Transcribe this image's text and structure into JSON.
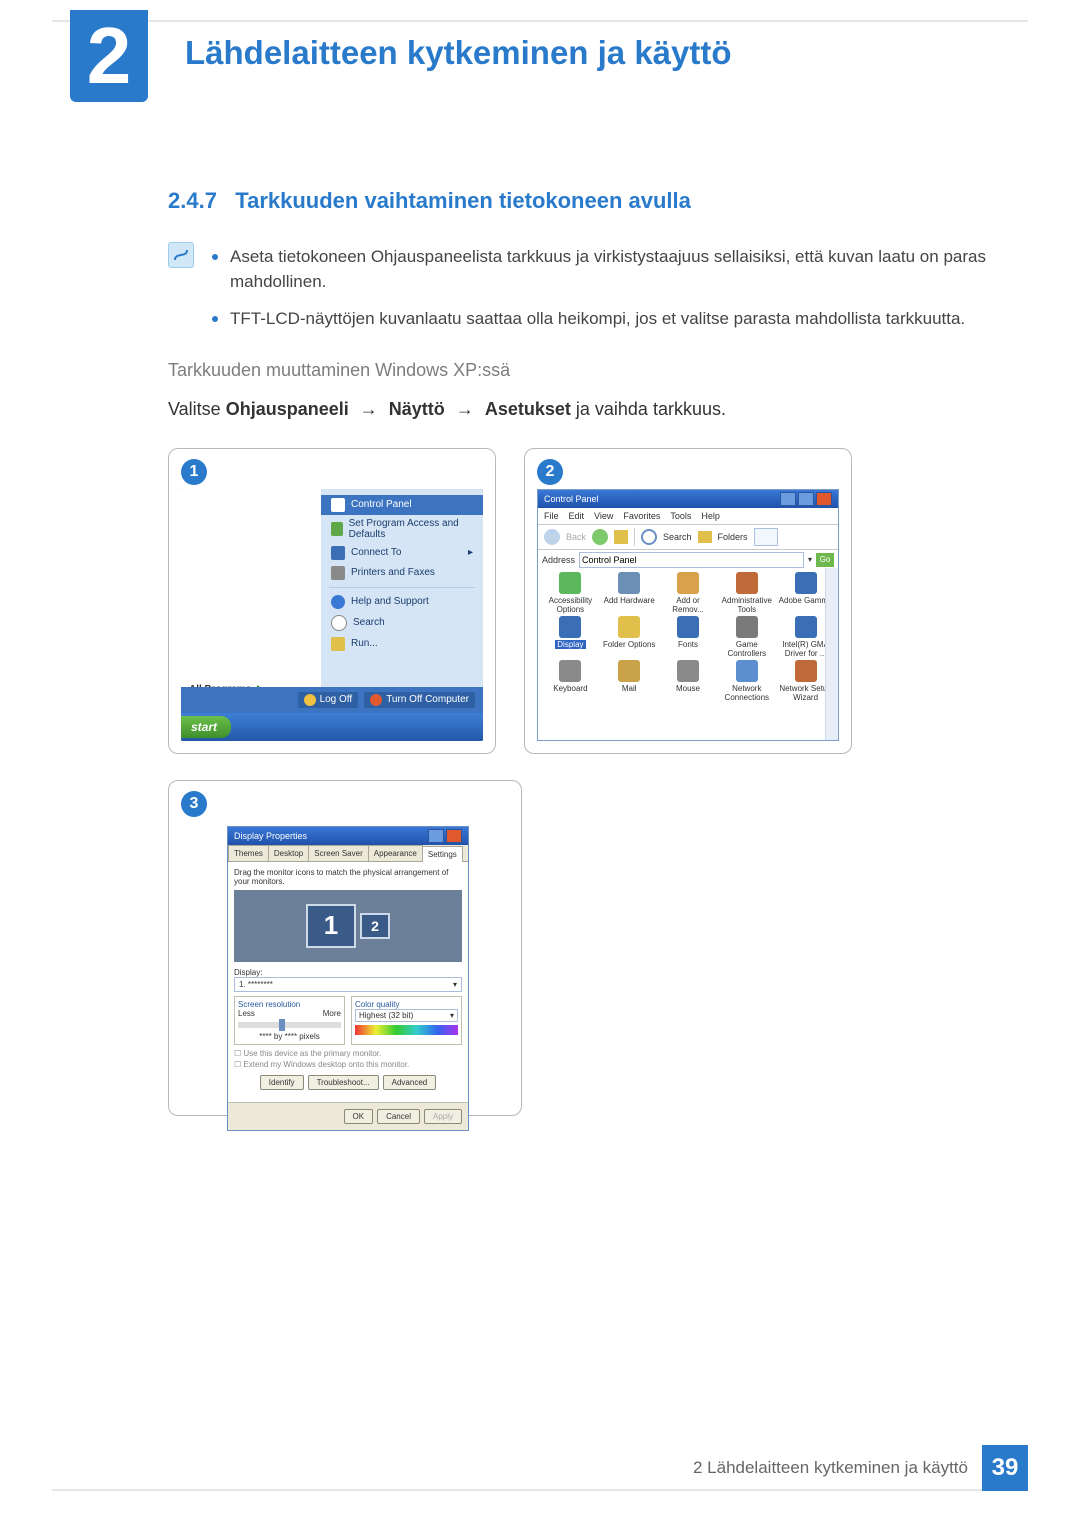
{
  "chapter": {
    "number": "2",
    "title": "Lähdelaitteen kytkeminen ja käyttö"
  },
  "section": {
    "number": "2.4.7",
    "title": "Tarkkuuden vaihtaminen tietokoneen avulla"
  },
  "notes": {
    "bullet1": "Aseta tietokoneen Ohjauspaneelista tarkkuus ja virkistystaajuus sellaisiksi, että kuvan laatu on paras mahdollinen.",
    "bullet2": "TFT-LCD-näyttöjen kuvanlaatu saattaa olla heikompi, jos et valitse parasta mahdollista tarkkuutta."
  },
  "sub_heading": "Tarkkuuden muuttaminen Windows XP:ssä",
  "path": {
    "prefix": "Valitse ",
    "step1": "Ohjauspaneeli",
    "step2": "Näyttö",
    "step3": "Asetukset",
    "suffix": " ja vaihda tarkkuus.",
    "arrow": "→"
  },
  "shots": {
    "n1": "1",
    "n2": "2",
    "n3": "3"
  },
  "start_menu": {
    "control_panel": "Control Panel",
    "set_program": "Set Program Access and Defaults",
    "connect_to": "Connect To",
    "printers": "Printers and Faxes",
    "help": "Help and Support",
    "search": "Search",
    "run": "Run...",
    "all_programs": "All Programs",
    "log_off": "Log Off",
    "turn_off": "Turn Off Computer",
    "start": "start"
  },
  "cp": {
    "title": "Control Panel",
    "menu": {
      "file": "File",
      "edit": "Edit",
      "view": "View",
      "fav": "Favorites",
      "tools": "Tools",
      "help": "Help"
    },
    "toolbar": {
      "back": "Back",
      "search_label": "Search",
      "folders": "Folders"
    },
    "addr_label": "Address",
    "addr_value": "Control Panel",
    "go": "Go",
    "icons": [
      {
        "label": "Accessibility Options",
        "color": "#5cb85c"
      },
      {
        "label": "Add Hardware",
        "color": "#6b8fb5"
      },
      {
        "label": "Add or Remov...",
        "color": "#d9a24a"
      },
      {
        "label": "Administrative Tools",
        "color": "#c06a3a"
      },
      {
        "label": "Adobe Gamma",
        "color": "#3a6fb5"
      },
      {
        "label": "Display",
        "color": "#3a6fb5",
        "sel": true
      },
      {
        "label": "Folder Options",
        "color": "#e0c04a"
      },
      {
        "label": "Fonts",
        "color": "#3a6fb5"
      },
      {
        "label": "Game Controllers",
        "color": "#7a7a7a"
      },
      {
        "label": "Intel(R) GMA Driver for ...",
        "color": "#3a6fb5"
      },
      {
        "label": "Keyboard",
        "color": "#8a8a8a"
      },
      {
        "label": "Mail",
        "color": "#c9a24a"
      },
      {
        "label": "Mouse",
        "color": "#8a8a8a"
      },
      {
        "label": "Network Connections",
        "color": "#5c8fd0"
      },
      {
        "label": "Network Setup Wizard",
        "color": "#c06a3a"
      }
    ]
  },
  "dp": {
    "title": "Display Properties",
    "tabs": {
      "themes": "Themes",
      "desktop": "Desktop",
      "saver": "Screen Saver",
      "appearance": "Appearance",
      "settings": "Settings"
    },
    "hint": "Drag the monitor icons to match the physical arrangement of your monitors.",
    "mon1": "1",
    "mon2": "2",
    "display_label": "Display:",
    "display_value": "1. ********",
    "res_label": "Screen resolution",
    "less": "Less",
    "more": "More",
    "res_value": "**** by **** pixels",
    "cq_label": "Color quality",
    "cq_value": "Highest (32 bit)",
    "chk1": "Use this device as the primary monitor.",
    "chk2": "Extend my Windows desktop onto this monitor.",
    "btn_identify": "Identify",
    "btn_trouble": "Troubleshoot...",
    "btn_adv": "Advanced",
    "ok": "OK",
    "cancel": "Cancel",
    "apply": "Apply"
  },
  "footer": {
    "text": "2 Lähdelaitteen kytkeminen ja käyttö",
    "page": "39"
  }
}
